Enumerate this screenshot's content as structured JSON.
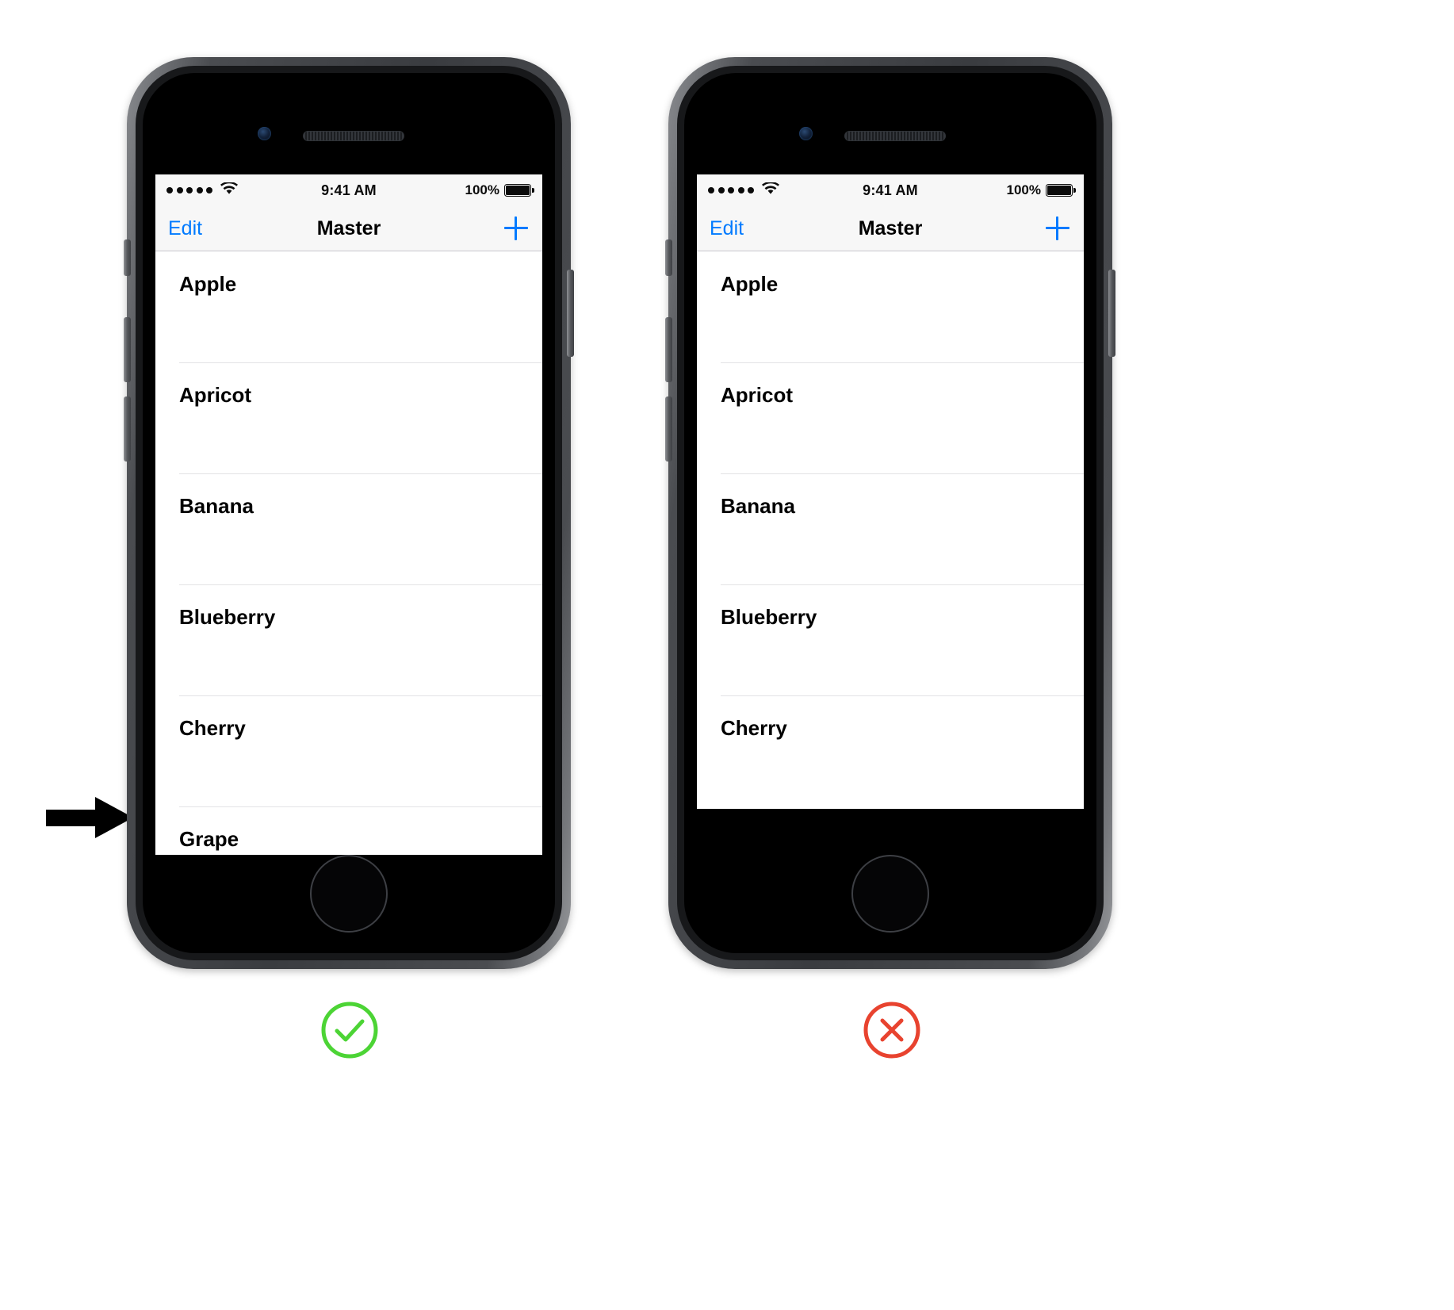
{
  "page": {
    "annotation_arrow": "right-arrow",
    "verdict_ok_icon": "checkmark-circle-icon",
    "verdict_bad_icon": "x-circle-icon",
    "ok_color": "#4cd435",
    "bad_color": "#e8432f"
  },
  "statusbar": {
    "signal_icon": "signal-dots-icon",
    "signal_bars": 5,
    "wifi_icon": "wifi-icon",
    "time": "9:41 AM",
    "battery_percent": "100%",
    "battery_icon": "battery-full-icon"
  },
  "navbar": {
    "edit_label": "Edit",
    "title": "Master",
    "add_icon": "plus-icon",
    "tint_color": "#007aff"
  },
  "phones": [
    {
      "id": "good-example",
      "items": [
        "Apple",
        "Apricot",
        "Banana",
        "Blueberry",
        "Cherry",
        "Grape"
      ]
    },
    {
      "id": "bad-example",
      "items": [
        "Apple",
        "Apricot",
        "Banana",
        "Blueberry",
        "Cherry"
      ]
    }
  ]
}
